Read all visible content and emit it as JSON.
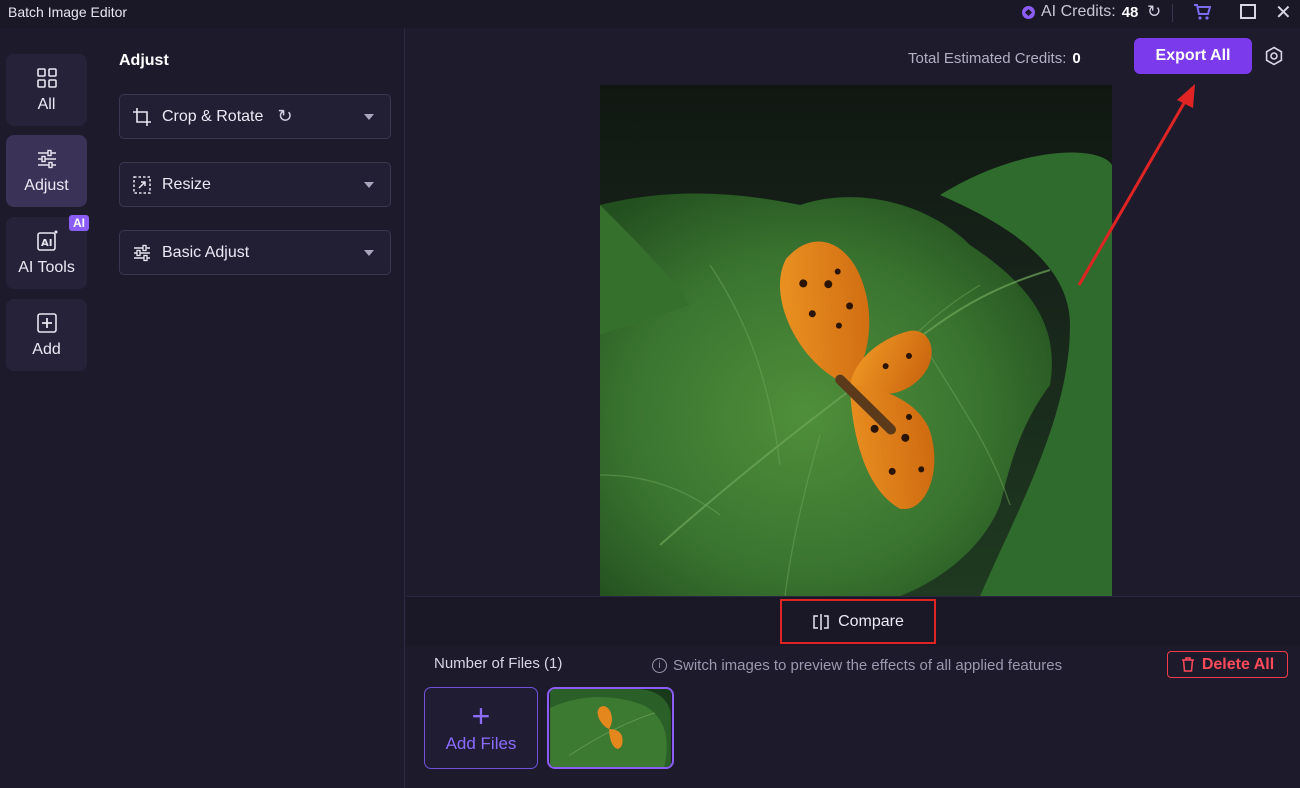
{
  "titlebar": {
    "app_title": "Batch Image Editor",
    "credits_label": "AI Credits:",
    "credits_value": "48"
  },
  "nav": {
    "items": [
      {
        "label": "All",
        "icon": "grid-icon"
      },
      {
        "label": "Adjust",
        "icon": "sliders-icon",
        "active": true
      },
      {
        "label": "AI Tools",
        "icon": "ai-tools-icon",
        "badge": "AI"
      },
      {
        "label": "Add",
        "icon": "plus-box-icon"
      }
    ]
  },
  "panel": {
    "title": "Adjust",
    "sections": [
      {
        "label": "Crop & Rotate",
        "icon": "crop-icon"
      },
      {
        "label": "Resize",
        "icon": "resize-icon"
      },
      {
        "label": "Basic Adjust",
        "icon": "sliders-icon"
      }
    ]
  },
  "main": {
    "total_credits_label": "Total Estimated Credits:",
    "total_credits_value": "0",
    "export_label": "Export All",
    "compare_label": "Compare"
  },
  "files": {
    "count_label": "Number of Files (1)",
    "hint": "Switch images to preview the effects of all applied features",
    "delete_label": "Delete All",
    "add_label": "Add Files"
  },
  "colors": {
    "accent": "#7c3aed",
    "danger": "#ef3b4b",
    "annotation": "#e02424"
  }
}
